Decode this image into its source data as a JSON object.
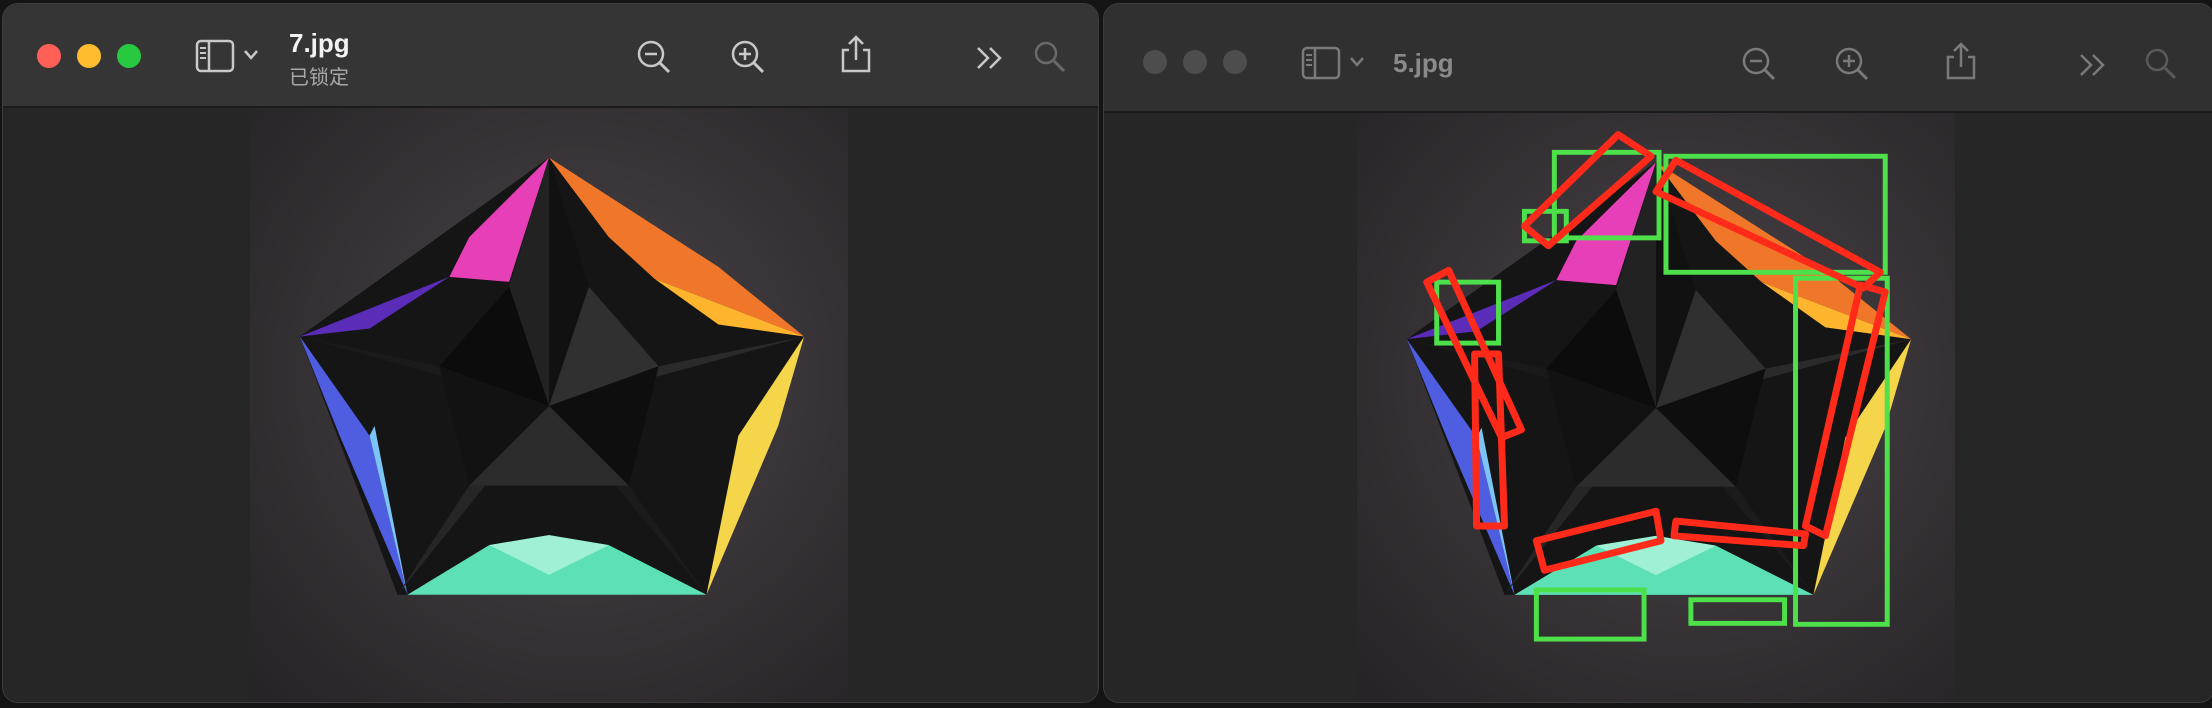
{
  "windows": [
    {
      "title": "7.jpg",
      "subtitle": "已锁定",
      "active": true,
      "image_name": "origami-star-image"
    },
    {
      "title": "5.jpg",
      "active": false,
      "image_name": "annotated-origami-star-image"
    }
  ],
  "toolbar_icons": [
    "sidebar-icon",
    "chevron-down-icon",
    "zoom-out-icon",
    "zoom-in-icon",
    "share-icon",
    "more-chevrons-icon",
    "search-icon"
  ],
  "colors": {
    "close": "#ff5f57",
    "minimize": "#febc2e",
    "zoom": "#28c840",
    "inactive_light": "#4d4d4d",
    "annotation_green": "#4ee04a",
    "annotation_red": "#ff2a1a"
  }
}
